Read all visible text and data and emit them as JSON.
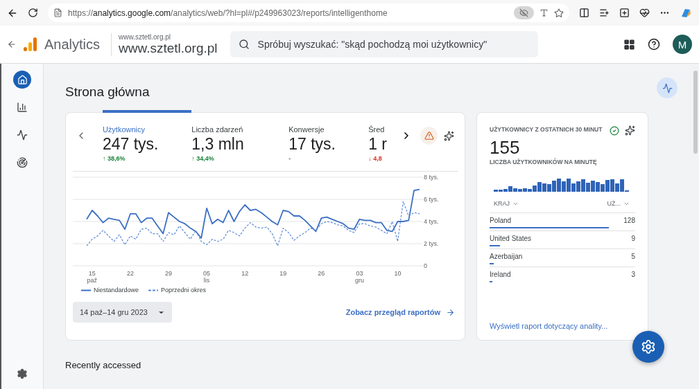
{
  "browser": {
    "url_scheme": "https://",
    "url_host": "analytics.google.com",
    "url_path": "/analytics/web/?hl=pl#/p249963023/reports/intelligenthome"
  },
  "app_header": {
    "product": "Analytics",
    "account": "www.sztetl.org.pl",
    "property": "www.sztetl.org.pl",
    "search_placeholder": "Spróbuj wyszukać: \"skąd pochodzą moi użytkownicy\"",
    "avatar": "M"
  },
  "sidebar": {
    "items": [
      {
        "kind": "home",
        "selected": true
      },
      {
        "kind": "reports",
        "selected": false
      },
      {
        "kind": "explore",
        "selected": false
      },
      {
        "kind": "advertising",
        "selected": false
      }
    ]
  },
  "page_title": "Strona główna",
  "metrics": [
    {
      "label": "Użytkownicy",
      "value": "247 tys.",
      "change": "↑ 38,6%",
      "color": "#188038",
      "selected": true
    },
    {
      "label": "Liczba zdarzeń",
      "value": "1,3 mln",
      "change": "↑ 34,4%",
      "color": "#188038",
      "selected": false
    },
    {
      "label": "Konwersje",
      "value": "17 tys.",
      "change": "-",
      "selected": false
    },
    {
      "label": "Śred",
      "value": "1 r",
      "change": "↓ 4,8",
      "color": "#d93025",
      "selected": false
    }
  ],
  "chart_data": {
    "type": "line",
    "categories": [
      null,
      "15 paź",
      null,
      null,
      null,
      null,
      null,
      null,
      "22",
      null,
      null,
      null,
      null,
      null,
      null,
      "29",
      null,
      null,
      null,
      null,
      null,
      null,
      "05 lis",
      null,
      null,
      null,
      null,
      null,
      null,
      "12",
      null,
      null,
      null,
      null,
      null,
      null,
      "19",
      null,
      null,
      null,
      null,
      null,
      null,
      "26",
      null,
      null,
      null,
      null,
      null,
      null,
      "03 gru",
      null,
      null,
      null,
      null,
      null,
      null,
      "10",
      null,
      null,
      null,
      null
    ],
    "grid": true,
    "series": [
      {
        "name": "Niestandardowe",
        "color": "#3b6fc4",
        "line_style": "solid",
        "values": [
          4.2,
          5.0,
          4.5,
          3.9,
          4.3,
          4.2,
          4.1,
          3.3,
          4.7,
          4.7,
          3.9,
          4.3,
          4.3,
          3.6,
          2.9,
          4.8,
          4.4,
          4.0,
          3.8,
          3.4,
          3.1,
          2.5,
          5.2,
          3.8,
          4.2,
          3.9,
          5.0,
          4.0,
          4.9,
          5.5,
          5.0,
          5.1,
          4.8,
          4.4,
          4.0,
          3.7,
          5.0,
          4.9,
          4.5,
          4.5,
          4.1,
          3.6,
          3.1,
          4.3,
          4.4,
          4.2,
          4.0,
          3.8,
          3.4,
          3.3,
          4.2,
          4.1,
          4.1,
          3.9,
          3.9,
          3.2,
          3.1,
          4.0,
          4.0,
          4.1,
          6.8,
          6.9
        ]
      },
      {
        "name": "Poprzedni okres",
        "color": "#5b8ad6",
        "line_style": "dashed",
        "values": [
          1.8,
          2.4,
          2.7,
          3.2,
          2.7,
          2.2,
          2.8,
          1.9,
          2.7,
          2.4,
          3.3,
          3.4,
          2.9,
          2.9,
          2.2,
          3.0,
          2.8,
          3.6,
          3.0,
          2.4,
          3.2,
          2.2,
          1.9,
          2.4,
          2.2,
          2.4,
          3.2,
          3.0,
          2.7,
          3.4,
          3.9,
          3.5,
          3.4,
          3.5,
          2.9,
          1.8,
          3.4,
          3.0,
          2.3,
          2.7,
          3.0,
          3.4,
          3.2,
          3.8,
          4.0,
          3.9,
          3.7,
          3.6,
          3.2,
          3.0,
          3.8,
          3.8,
          3.6,
          3.5,
          3.2,
          2.9,
          4.0,
          2.2,
          5.8,
          4.5,
          4.8,
          4.7
        ]
      }
    ],
    "ylim": [
      0,
      8
    ],
    "yticks": [
      {
        "value": 0,
        "label": "0"
      },
      {
        "value": 2,
        "label": "2 tys."
      },
      {
        "value": 4,
        "label": "4 tys."
      },
      {
        "value": 6,
        "label": "6 tys."
      },
      {
        "value": 8,
        "label": "8 tys."
      }
    ]
  },
  "date_range": "14 paź–14 gru 2023",
  "report_link": "Zobacz przegląd raportów",
  "realtime": {
    "title": "UŻYTKOWNICY Z OSTATNICH 30 MINUT",
    "value": "155",
    "subtitle": "LICZBA UŻYTKOWNIKÓW NA MINUTĘ",
    "columns": [
      "KRAJ",
      "UŻ..."
    ],
    "rows": [
      {
        "country": "Poland",
        "count": "128",
        "level": 0.82
      },
      {
        "country": "United States",
        "count": "9",
        "level": 0.07
      },
      {
        "country": "Azerbaijan",
        "count": "5",
        "level": 0.03
      },
      {
        "country": "Ireland",
        "count": "3",
        "level": 0.02
      }
    ],
    "link": "Wyświetl raport dotyczący anality..."
  },
  "recent_title": "Recently accessed"
}
